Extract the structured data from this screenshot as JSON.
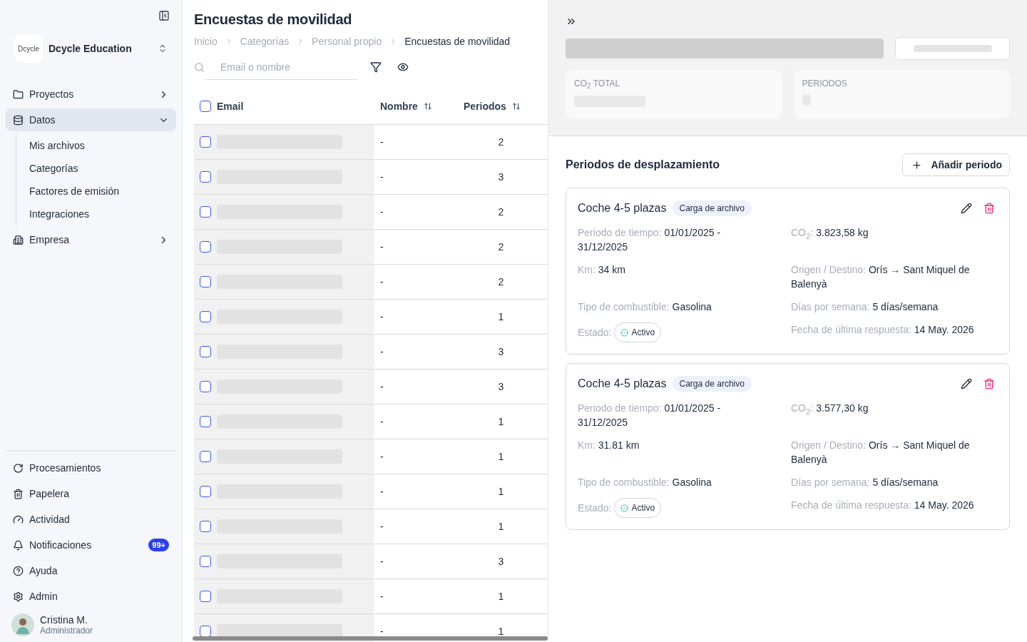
{
  "sidebar": {
    "org": {
      "logo": "Dcycle",
      "name": "Dcycle Education"
    },
    "nav": [
      {
        "label": "Proyectos",
        "expanded": false,
        "selected": false
      },
      {
        "label": "Datos",
        "expanded": true,
        "selected": true,
        "children": [
          {
            "label": "Mis archivos",
            "selected": false
          },
          {
            "label": "Categorías",
            "selected": false
          },
          {
            "label": "Factores de emisión",
            "selected": false
          },
          {
            "label": "Integraciones",
            "selected": false
          }
        ]
      },
      {
        "label": "Empresa",
        "expanded": false,
        "selected": false
      }
    ],
    "bottom": [
      {
        "label": "Procesamientos"
      },
      {
        "label": "Papelera"
      },
      {
        "label": "Actividad"
      },
      {
        "label": "Notificaciones",
        "badge": "99+"
      },
      {
        "label": "Ayuda"
      },
      {
        "label": "Admin"
      }
    ],
    "user": {
      "name": "Cristina M.",
      "role": "Administrador"
    }
  },
  "list": {
    "title": "Encuestas de movilidad",
    "breadcrumb": [
      {
        "label": "Inicio",
        "current": false
      },
      {
        "label": "Categorías",
        "current": false
      },
      {
        "label": "Personal propio",
        "current": false
      },
      {
        "label": "Encuestas de movilidad",
        "current": true
      }
    ],
    "search": {
      "placeholder": "Email o nombre"
    },
    "columns": [
      {
        "label": "Email",
        "sortable": false
      },
      {
        "label": "Nombre",
        "sortable": true
      },
      {
        "label": "Periodos",
        "sortable": true
      }
    ],
    "header_checked": false,
    "rows": [
      {
        "checked": false,
        "nombre": "-",
        "periodos": "2"
      },
      {
        "checked": false,
        "nombre": "-",
        "periodos": "3"
      },
      {
        "checked": false,
        "nombre": "-",
        "periodos": "2"
      },
      {
        "checked": false,
        "nombre": "-",
        "periodos": "2"
      },
      {
        "checked": false,
        "nombre": "-",
        "periodos": "2"
      },
      {
        "checked": false,
        "nombre": "-",
        "periodos": "1"
      },
      {
        "checked": false,
        "nombre": "-",
        "periodos": "3"
      },
      {
        "checked": false,
        "nombre": "-",
        "periodos": "3"
      },
      {
        "checked": false,
        "nombre": "-",
        "periodos": "1"
      },
      {
        "checked": false,
        "nombre": "-",
        "periodos": "1"
      },
      {
        "checked": false,
        "nombre": "-",
        "periodos": "1"
      },
      {
        "checked": false,
        "nombre": "-",
        "periodos": "1"
      },
      {
        "checked": false,
        "nombre": "-",
        "periodos": "3"
      },
      {
        "checked": false,
        "nombre": "-",
        "periodos": "1"
      },
      {
        "checked": false,
        "nombre": "-",
        "periodos": "1"
      }
    ]
  },
  "detail": {
    "stats": [
      {
        "label": "CO$_{2}$ TOTAL"
      },
      {
        "label": "PERIODOS"
      }
    ],
    "section_title": "Periodos de desplazamiento",
    "add_button": "Añadir periodo",
    "periods": [
      {
        "title": "Coche 4-5 plazas",
        "tag": "Carga de archivo",
        "fields": [
          {
            "kind": "text",
            "label": "Periodo de tiempo:",
            "value": "01/01/2025 - 31/12/2025"
          },
          {
            "kind": "text",
            "label": "CO$_{2}$:",
            "value": "3.823,58 kg"
          },
          {
            "kind": "text",
            "label": "Km:",
            "value": "34 km"
          },
          {
            "kind": "text",
            "label": "Origen / Destino:",
            "value": "Orís → Sant Miquel de Balenyà"
          },
          {
            "kind": "text",
            "label": "Tipo de combustible:",
            "value": "Gasolina"
          },
          {
            "kind": "text",
            "label": "Días por semana:",
            "value": "5 días/semana"
          },
          {
            "kind": "status",
            "label": "Estado:",
            "value": "Activo"
          },
          {
            "kind": "text",
            "label": "Fecha de última respuesta:",
            "value": "14 May. 2026"
          }
        ]
      },
      {
        "title": "Coche 4-5 plazas",
        "tag": "Carga de archivo",
        "fields": [
          {
            "kind": "text",
            "label": "Periodo de tiempo:",
            "value": "01/01/2025 - 31/12/2025"
          },
          {
            "kind": "text",
            "label": "CO$_{2}$:",
            "value": "3.577,30 kg"
          },
          {
            "kind": "text",
            "label": "Km:",
            "value": "31.81 km"
          },
          {
            "kind": "text",
            "label": "Origen / Destino:",
            "value": "Orís → Sant Miquel de Balenyà"
          },
          {
            "kind": "text",
            "label": "Tipo de combustible:",
            "value": "Gasolina"
          },
          {
            "kind": "text",
            "label": "Días por semana:",
            "value": "5 días/semana"
          },
          {
            "kind": "status",
            "label": "Estado:",
            "value": "Activo"
          },
          {
            "kind": "text",
            "label": "Fecha de última respuesta:",
            "value": "14 May. 2026"
          }
        ]
      }
    ]
  }
}
